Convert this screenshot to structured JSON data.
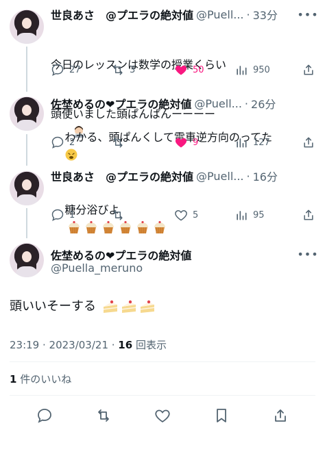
{
  "tweets": [
    {
      "name": "世良あさ　@プエラの絶対値",
      "handle": "@Puell...",
      "time": "33分",
      "text_line1": "今日のレッスンは数学の授業くらい",
      "text_line2": "頭使いました頭ぱんぱんーーーー",
      "emoji": "woman-technologist-emoji",
      "replies": "27",
      "retweets": "3",
      "likes": "50",
      "views": "950",
      "liked": true
    },
    {
      "name": "佐埜めるの❤プエラの絶対値",
      "handle": "@Puell...",
      "time": "26分",
      "text_line1": "わかる、頭ぱんくして電車逆方向のってた",
      "emoji": "weary-face-emoji",
      "replies": "2",
      "retweets": "",
      "likes": "9",
      "views": "127",
      "liked": true
    },
    {
      "name": "世良あさ　@プエラの絶対値",
      "handle": "@Puell...",
      "time": "16分",
      "text_line1": "糖分浴びよ",
      "emoji": "cupcake-emoji x6",
      "replies": "1",
      "retweets": "",
      "likes": "5",
      "views": "95",
      "liked": false
    }
  ],
  "main_tweet": {
    "name": "佐埜めるの❤プエラの絶対値",
    "handle": "@Puella_meruno",
    "text": "頭いいそーする",
    "emoji": "shortcake-emoji x3",
    "time": "23:19 · 2023/03/21 · ",
    "views_count": "16",
    "views_label": " 回表示",
    "likes_count": "1",
    "likes_label": " 件のいいね"
  },
  "colors": {
    "like_pink": "#f91880",
    "muted": "#536471",
    "text": "#0f1419",
    "divider": "#eff3f4"
  },
  "icons": [
    "reply-icon",
    "retweet-icon",
    "like-icon",
    "views-icon",
    "share-icon",
    "bookmark-icon",
    "more-icon"
  ]
}
